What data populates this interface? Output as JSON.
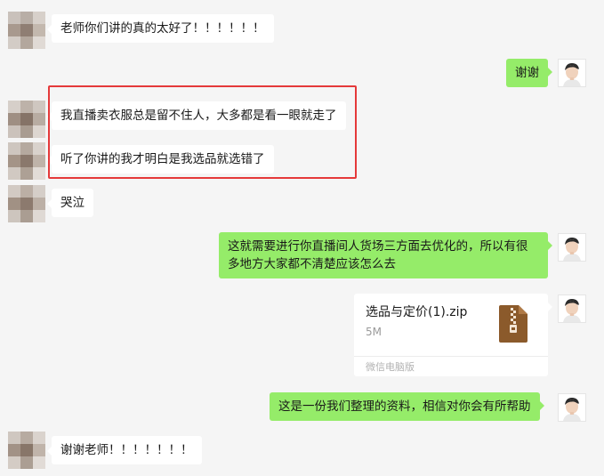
{
  "messages": {
    "m1": "老师你们讲的真的太好了！！！！！！",
    "m2": "谢谢",
    "m3": "我直播卖衣服总是留不住人，大多都是看一眼就走了",
    "m4": "听了你讲的我才明白是我选品就选错了",
    "m5": "哭泣",
    "m6": "这就需要进行你直播间人货场三方面去优化的，所以有很多地方大家都不清楚应该怎么去",
    "m8": "这是一份我们整理的资料，相信对你会有所帮助",
    "m9": "谢谢老师！！！！！！！"
  },
  "file": {
    "name": "选品与定价(1).zip",
    "size": "5M",
    "source": "微信电脑版",
    "icon": "zip-file-icon"
  },
  "colors": {
    "background": "#f5f5f5",
    "incoming_bubble": "#ffffff",
    "outgoing_bubble": "#95ec69",
    "highlight": "#e5393a",
    "zip_icon": "#8b5a2b"
  }
}
